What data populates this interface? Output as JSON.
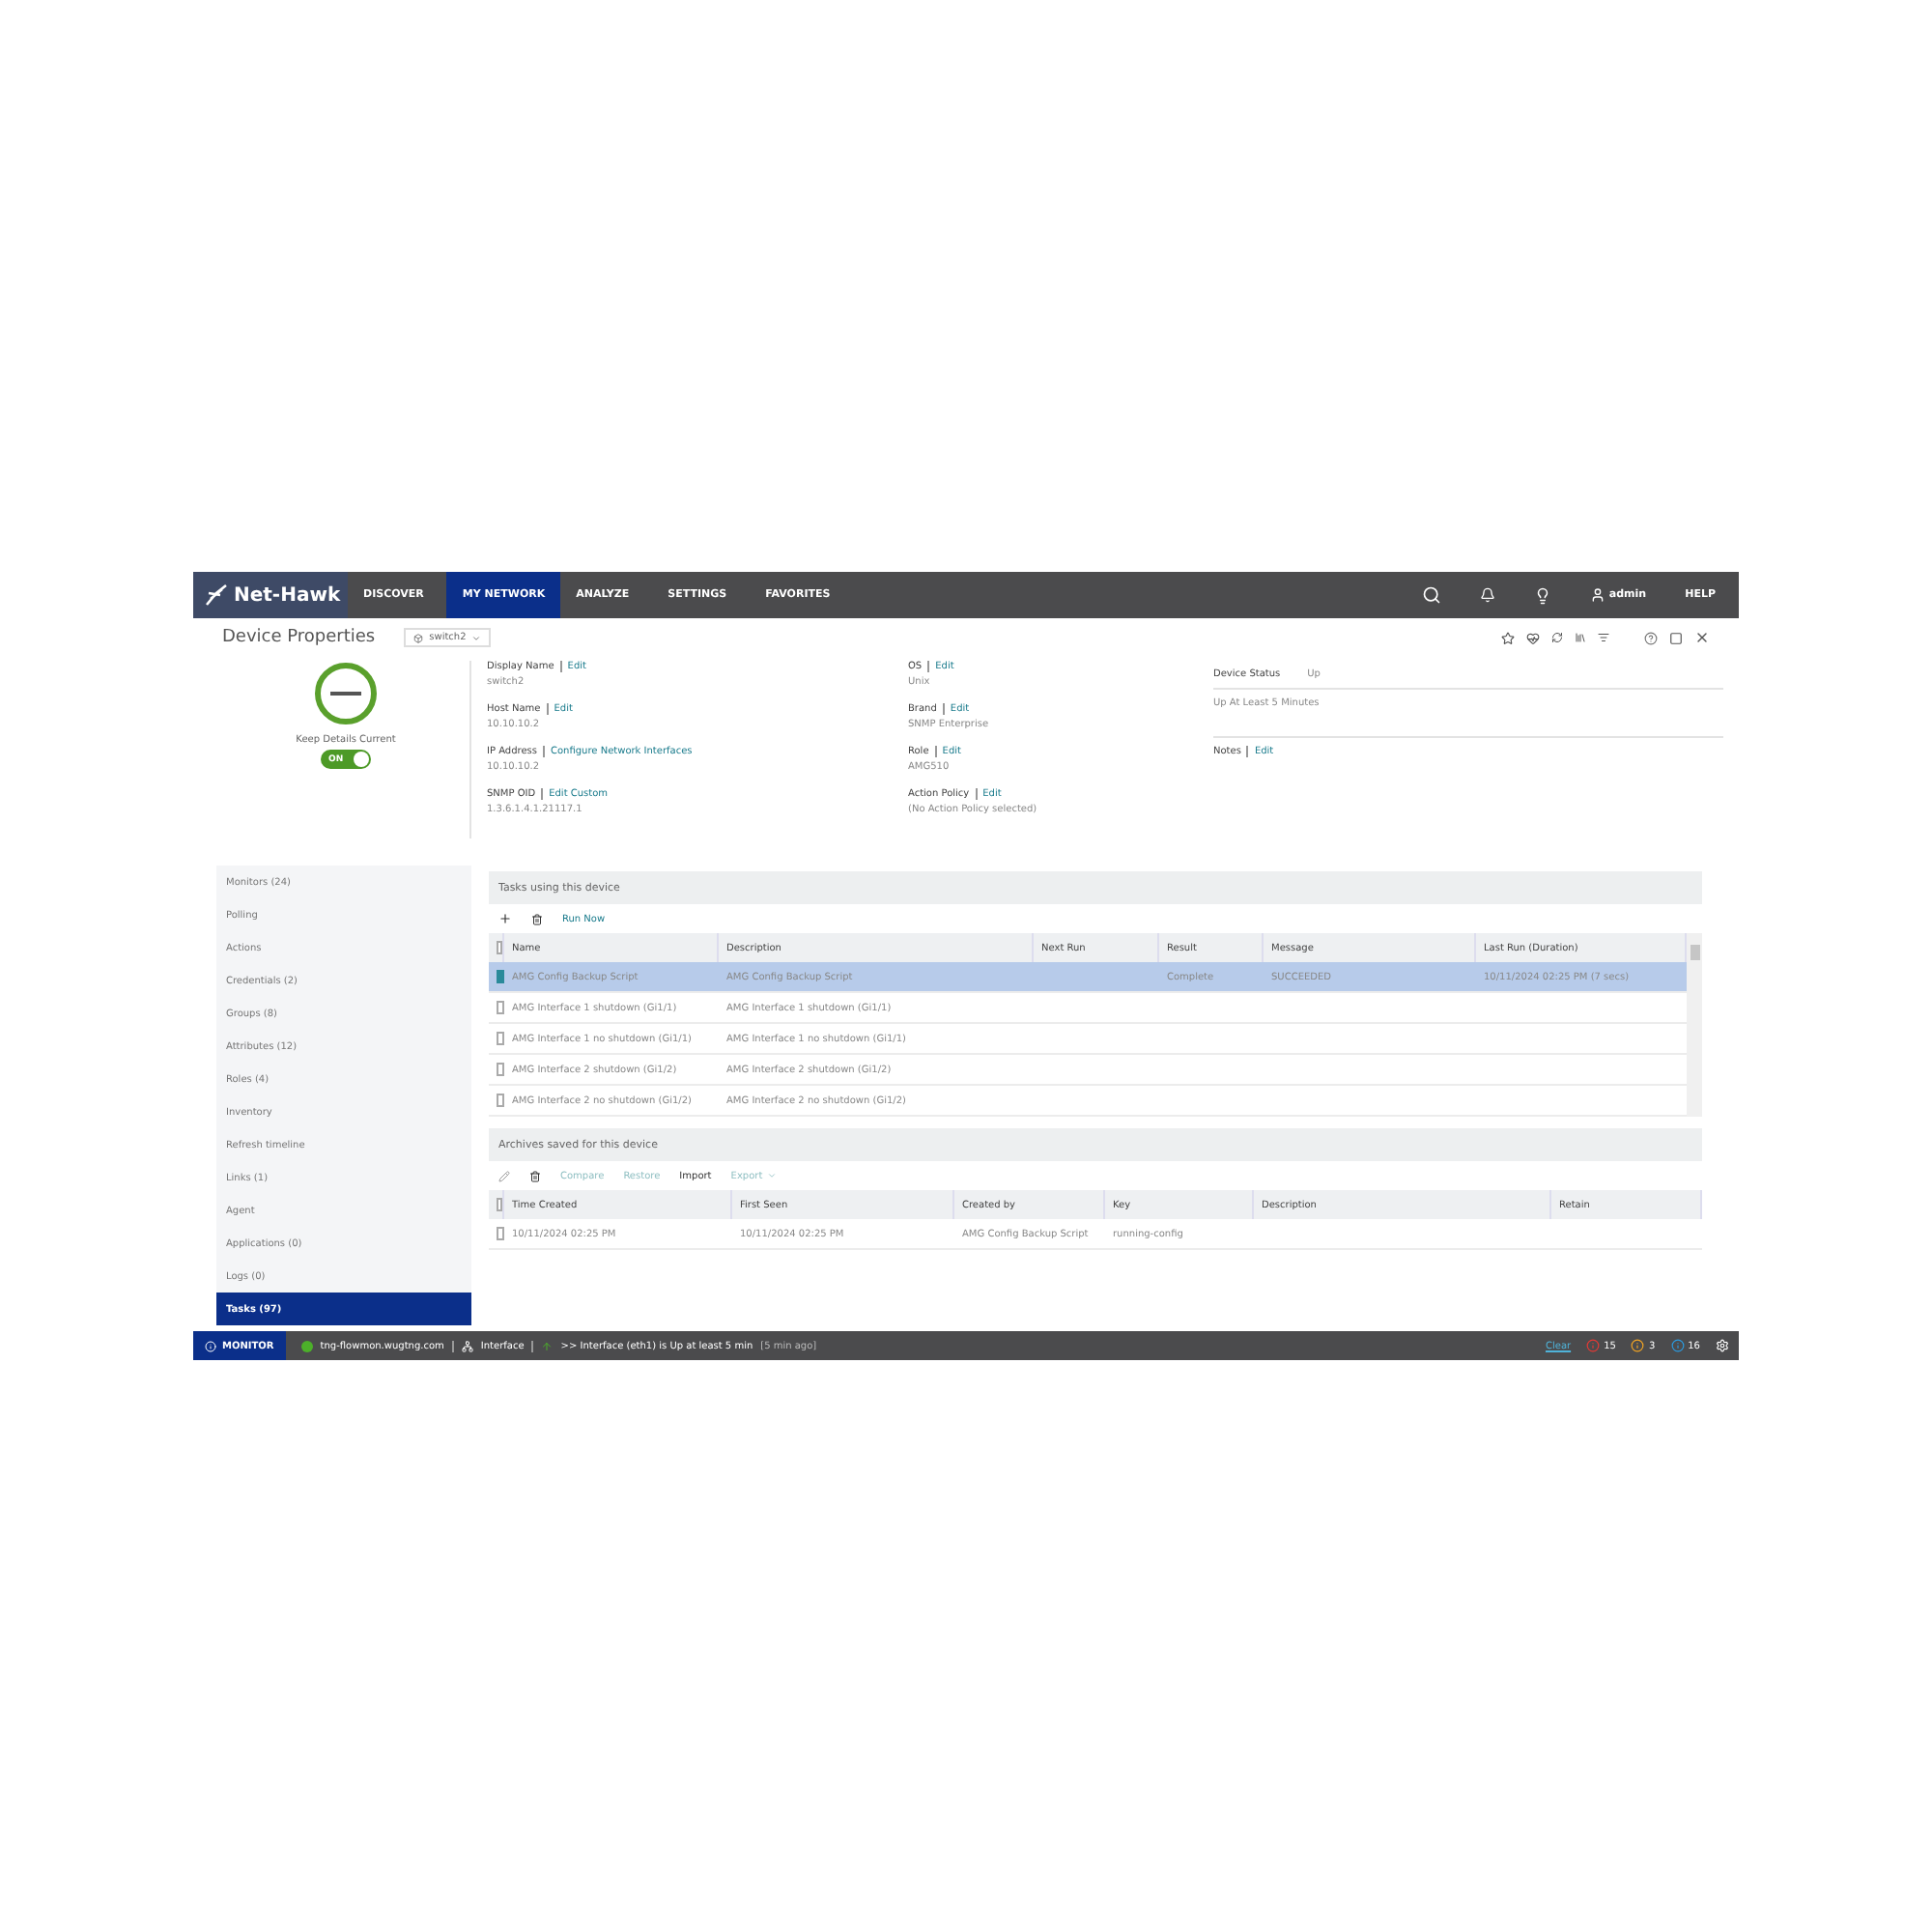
{
  "nav": {
    "logo": "Net-Hawk",
    "items": [
      {
        "label": "DISCOVER",
        "selected": false
      },
      {
        "label": "MY NETWORK",
        "selected": true
      },
      {
        "label": "ANALYZE",
        "selected": false
      },
      {
        "label": "SETTINGS",
        "selected": false
      },
      {
        "label": "FAVORITES",
        "selected": false
      }
    ],
    "user": "admin",
    "help": "HELP"
  },
  "header": {
    "title": "Device Properties",
    "device_selector": "switch2"
  },
  "details": {
    "keep_current_label": "Keep Details Current",
    "keep_current": {
      "on": true,
      "label": "ON"
    },
    "fields_left": [
      {
        "label": "Display Name",
        "action": "Edit",
        "value": "switch2"
      },
      {
        "label": "Host Name",
        "action": "Edit",
        "value": "10.10.10.2"
      },
      {
        "label": "IP Address",
        "action": "Configure Network Interfaces",
        "value": "10.10.10.2"
      },
      {
        "label": "SNMP OID",
        "action": "Edit Custom",
        "value": "1.3.6.1.4.1.21117.1"
      }
    ],
    "fields_middle": [
      {
        "label": "OS",
        "action": "Edit",
        "value": "Unix"
      },
      {
        "label": "Brand",
        "action": "Edit",
        "value": "SNMP Enterprise"
      },
      {
        "label": "Role",
        "action": "Edit",
        "value": "AMG510"
      },
      {
        "label": "Action Policy",
        "action": "Edit",
        "value": "(No Action Policy selected)"
      }
    ],
    "status": {
      "label": "Device Status",
      "value": "Up",
      "detail": "Up At Least 5 Minutes"
    },
    "notes": {
      "label": "Notes",
      "action": "Edit"
    }
  },
  "sidebar": {
    "items": [
      {
        "label": "Monitors (24)",
        "selected": false
      },
      {
        "label": "Polling",
        "selected": false
      },
      {
        "label": "Actions",
        "selected": false
      },
      {
        "label": "Credentials (2)",
        "selected": false
      },
      {
        "label": "Groups (8)",
        "selected": false
      },
      {
        "label": "Attributes (12)",
        "selected": false
      },
      {
        "label": "Roles (4)",
        "selected": false
      },
      {
        "label": "Inventory",
        "selected": false
      },
      {
        "label": "Refresh timeline",
        "selected": false
      },
      {
        "label": "Links (1)",
        "selected": false
      },
      {
        "label": "Agent",
        "selected": false
      },
      {
        "label": "Applications (0)",
        "selected": false
      },
      {
        "label": "Logs (0)",
        "selected": false
      },
      {
        "label": "Tasks (97)",
        "selected": true
      }
    ]
  },
  "tasks": {
    "title": "Tasks using this device",
    "all_checked": false,
    "run_now": "Run Now",
    "columns": [
      "Name",
      "Description",
      "Next Run",
      "Result",
      "Message",
      "Last Run (Duration)"
    ],
    "rows": [
      {
        "checked": true,
        "selected": true,
        "cells": [
          "AMG Config Backup Script",
          "AMG Config Backup Script",
          "",
          "Complete",
          "SUCCEEDED",
          "10/11/2024 02:25 PM (7 secs)"
        ]
      },
      {
        "checked": false,
        "selected": false,
        "cells": [
          "AMG Interface 1 shutdown (Gi1/1)",
          "AMG Interface 1 shutdown (Gi1/1)",
          "",
          "",
          "",
          ""
        ]
      },
      {
        "checked": false,
        "selected": false,
        "cells": [
          "AMG Interface 1 no shutdown (Gi1/1)",
          "AMG Interface 1 no shutdown (Gi1/1)",
          "",
          "",
          "",
          ""
        ]
      },
      {
        "checked": false,
        "selected": false,
        "cells": [
          "AMG Interface 2 shutdown (Gi1/2)",
          "AMG Interface 2 shutdown (Gi1/2)",
          "",
          "",
          "",
          ""
        ]
      },
      {
        "checked": false,
        "selected": false,
        "cells": [
          "AMG Interface 2 no shutdown (Gi1/2)",
          "AMG Interface 2 no shutdown (Gi1/2)",
          "",
          "",
          "",
          ""
        ]
      }
    ]
  },
  "archives": {
    "title": "Archives saved for this device",
    "all_checked": false,
    "actions": [
      {
        "label": "Compare",
        "disabled": true,
        "menu": false
      },
      {
        "label": "Restore",
        "disabled": true,
        "menu": false
      },
      {
        "label": "Import",
        "disabled": false,
        "menu": false
      },
      {
        "label": "Export",
        "disabled": true,
        "menu": true
      }
    ],
    "columns": [
      "Time Created",
      "First Seen",
      "Created by",
      "Key",
      "Description",
      "Retain"
    ],
    "rows": [
      {
        "checked": false,
        "cells": [
          "10/11/2024 02:25 PM",
          "10/11/2024 02:25 PM",
          "AMG Config Backup Script",
          "running-config",
          "",
          ""
        ]
      }
    ]
  },
  "status_bar": {
    "monitor": "MONITOR",
    "host": "tng-flowmon.wugtng.com",
    "type": "Interface",
    "message": ">> Interface (eth1) is Up at least 5 min",
    "age": "[5 min ago]",
    "clear": "Clear",
    "counts": [
      {
        "kind": "error",
        "value": "15"
      },
      {
        "kind": "warning",
        "value": "3"
      },
      {
        "kind": "info",
        "value": "16"
      }
    ]
  }
}
